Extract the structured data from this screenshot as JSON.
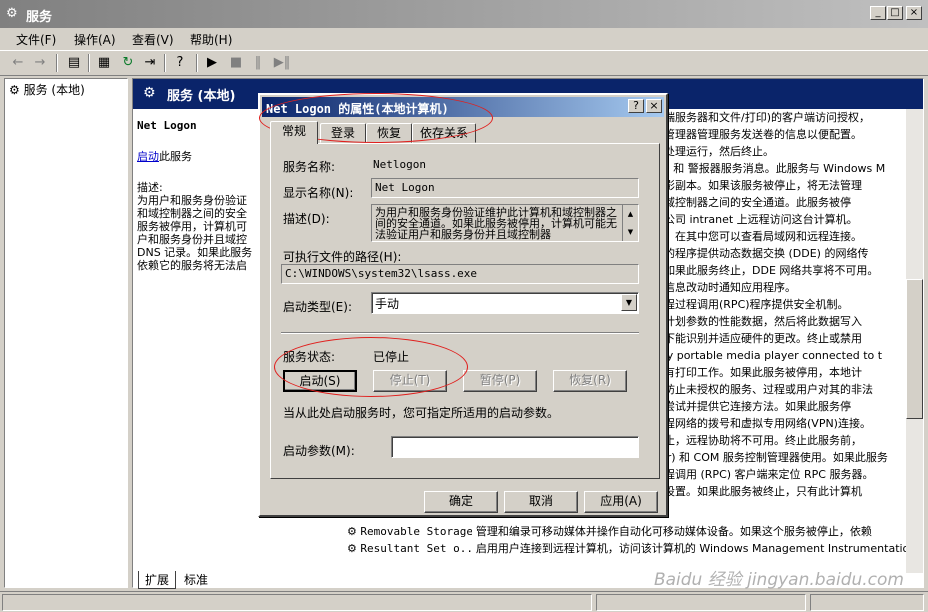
{
  "window": {
    "title": "服务"
  },
  "menu": [
    "文件(F)",
    "操作(A)",
    "查看(V)",
    "帮助(H)"
  ],
  "toolbar": {
    "icons": [
      "back-icon",
      "forward-icon",
      "up-icon",
      "properties-icon",
      "refresh-icon",
      "export-icon",
      "help-icon",
      "play-icon",
      "stop-icon",
      "pause-icon",
      "restart-icon"
    ]
  },
  "tree": {
    "root": "服务 (本地)"
  },
  "pane": {
    "title": "服务 (本地)",
    "service_name": "Net Logon",
    "start_link": "启动",
    "start_suffix": "此服务",
    "desc_label": "描述:",
    "desc_lines": [
      "为用户和服务身份验证",
      "和域控制器之间的安全",
      "服务被停用，计算机可",
      "户和服务身份并且域控",
      "DNS 记录。如果此服务",
      "依赖它的服务将无法启"
    ]
  },
  "list_right": [
    "终端服务器和文件/打印)的客户端访问授权，",
    "盘管理器管理服务发送卷的信息以便配置。",
    "置处理运行，然后终止。",
    "ND 和 警报器服务消息。此服务与 Windows M",
    "卷影副本。如果该服务被停止，将无法管理",
    "和域控制器之间的安全通道。此服务被停",
    "在公司 intranet 上远程访问这台计算机。",
    "象，在其中您可以查看局域网和远程连接。",
    "行的程序提供动态数据交换 (DDE) 的网络传",
    "。如果此服务终止，DDE 网络共享将不可用。",
    "在信息改动时通知应用程序。",
    "远程过程调用(RPC)程序提供安全机制。",
    "的计划参数的性能数据，然后将此数据写入",
    "况下能识别并适应硬件的更改。终止或禁用",
    "any portable media player connected to t",
    "所有打印工作。如果此服务被停用，本地计",
    "要防止未授权的服务、过程或用户对其的非法",
    "功尝试并提供它连接方法。如果此服务停",
    "远程网络的拨号和虚拟专用网络(VPN)连接。",
    "终止，远程协助将不可用。终止此服务前，",
    "per) 和 COM 服务控制管理器使用。如果此服务",
    "过程调用 (RPC) 客户端来定位 RPC 服务器。",
    "表设置。如果此服务被终止，只有此计算机"
  ],
  "list_bottom": [
    {
      "name": "Removable Storage",
      "desc": "管理和编录可移动媒体并操作自动化可移动媒体设备。如果这个服务被停止，依赖"
    },
    {
      "name": "Resultant Set o...",
      "desc": "启用用户连接到远程计算机，访问该计算机的 Windows Management Instrumentation"
    }
  ],
  "bottom_tabs": [
    "扩展",
    "标准"
  ],
  "dialog": {
    "title": "Net Logon 的属性(本地计算机)",
    "help_btn": "?",
    "close_btn": "×",
    "tabs": [
      "常规",
      "登录",
      "恢复",
      "依存关系"
    ],
    "active_tab": "常规",
    "service_name_label": "服务名称:",
    "service_name": "Netlogon",
    "display_name_label": "显示名称(N):",
    "display_name": "Net Logon",
    "description_label": "描述(D):",
    "description": "为用户和服务身份验证维护此计算机和域控制器之间的安全通道。如果此服务被停用，计算机可能无法验证用户和服务身份并且域控制器",
    "exe_path_label": "可执行文件的路径(H):",
    "exe_path": "C:\\WINDOWS\\system32\\lsass.exe",
    "startup_type_label": "启动类型(E):",
    "startup_type": "手动",
    "status_label": "服务状态:",
    "status_value": "已停止",
    "start_btn": "启动(S)",
    "stop_btn": "停止(T)",
    "pause_btn": "暂停(P)",
    "resume_btn": "恢复(R)",
    "hint": "当从此处启动服务时，您可指定所适用的启动参数。",
    "param_label": "启动参数(M):",
    "param_value": "",
    "ok_btn": "确定",
    "cancel_btn": "取消",
    "apply_btn": "应用(A)"
  },
  "watermark": "Baidu 经验 jingyan.baidu.com",
  "colors": {
    "titlebar_inactive": "#808080",
    "titlebar_active": "#0a246a",
    "highlight_ellipse": "#e0201e",
    "face": "#d4d0c8"
  }
}
